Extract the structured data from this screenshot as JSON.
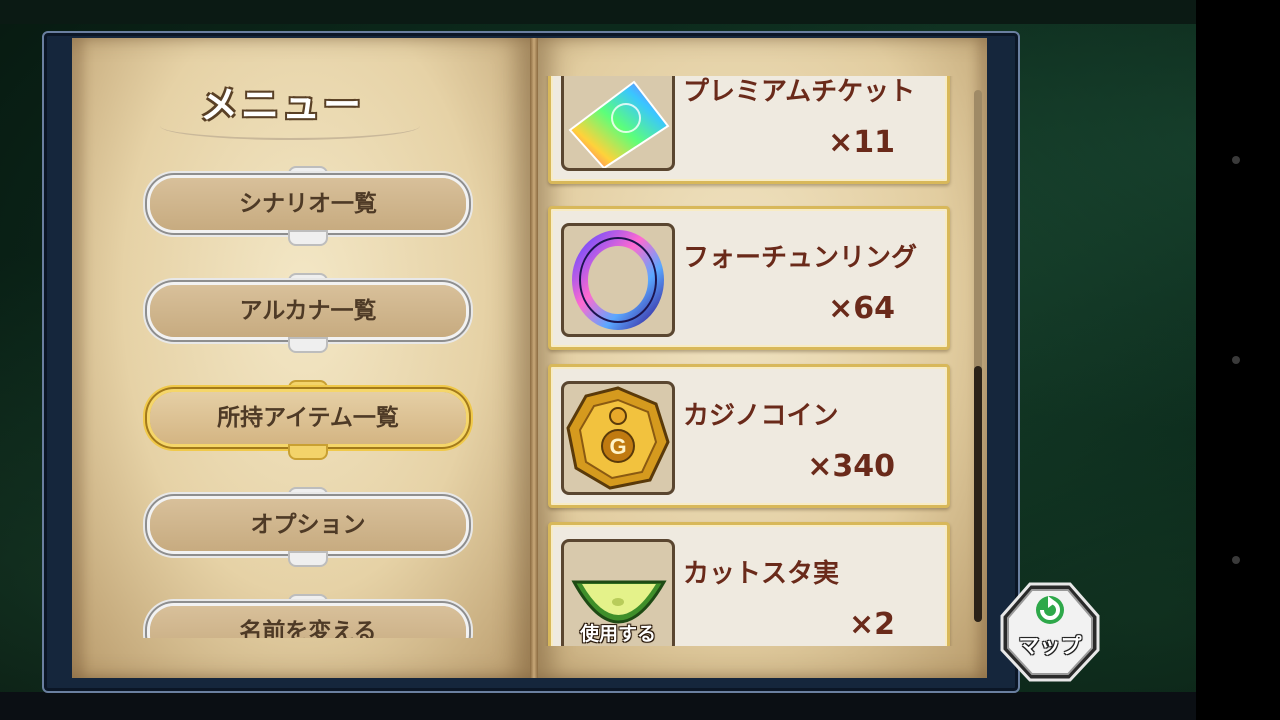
{
  "menu": {
    "title": "メニュー",
    "items": [
      {
        "label": "シナリオ一覧",
        "active": false
      },
      {
        "label": "アルカナ一覧",
        "active": false
      },
      {
        "label": "所持アイテム一覧",
        "active": true
      },
      {
        "label": "オプション",
        "active": false
      },
      {
        "label": "名前を変える",
        "active": false
      }
    ]
  },
  "items": [
    {
      "name": "プレミアムチケット",
      "count": "×11",
      "icon": "rainbow-ticket-icon"
    },
    {
      "name": "フォーチュンリング",
      "count": "×64",
      "icon": "fortune-ring-icon"
    },
    {
      "name": "カジノコイン",
      "count": "×340",
      "icon": "casino-coin-icon"
    },
    {
      "name": "カットスタ実",
      "count": "×2",
      "icon": "melon-slice-icon",
      "use_label": "使用する"
    }
  ],
  "map_button": {
    "label": "マップ",
    "icon": "refresh-arrow-icon"
  },
  "colors": {
    "active_gold": "#f0c94a",
    "item_text": "#6a2a1a",
    "frame": "#15263c"
  }
}
